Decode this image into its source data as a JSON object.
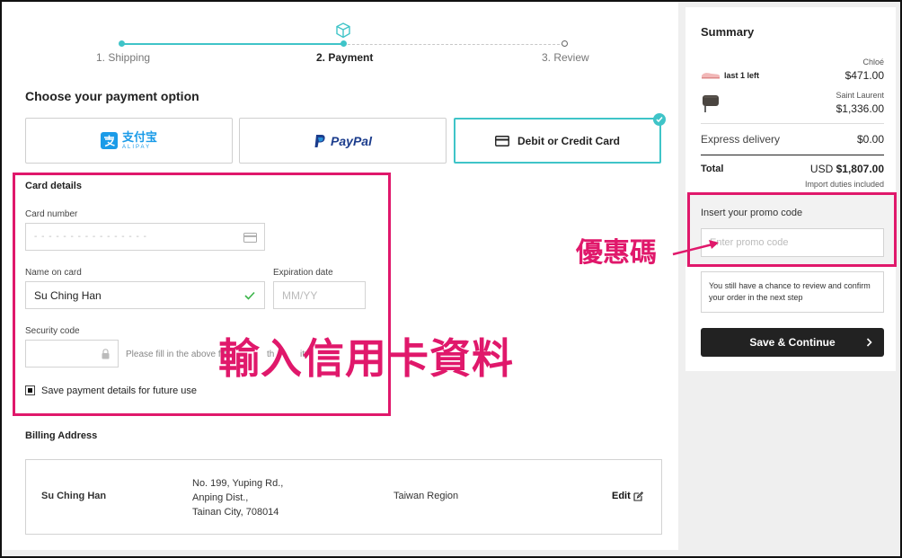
{
  "stepper": {
    "steps": [
      {
        "label": "1. Shipping"
      },
      {
        "label": "2. Payment"
      },
      {
        "label": "3. Review"
      }
    ],
    "active_index": 1,
    "accent": "#3fc4c8"
  },
  "payment": {
    "heading": "Choose your payment option",
    "options": [
      {
        "label": "支付宝",
        "sublabel": "ALIPAY"
      },
      {
        "label": "PayPal"
      },
      {
        "label": "Debit or Credit Card"
      }
    ],
    "selected_index": 2
  },
  "card": {
    "title": "Card details",
    "number_label": "Card number",
    "number_placeholder": "- - - -  - - - -  - - - -  - - - -",
    "name_label": "Name on card",
    "name_value": "Su Ching Han",
    "exp_label": "Expiration date",
    "exp_placeholder": "MM/YY",
    "cvv_label": "Security code",
    "cvv_hint_a": "Please fill in the above fie",
    "cvv_hint_b": "th",
    "cvv_hint_c": "ity",
    "save_label": "Save payment details for future use"
  },
  "billing": {
    "title": "Billing Address",
    "name": "Su Ching Han",
    "address_lines": [
      "No. 199, Yuping Rd.,",
      "Anping Dist.,",
      "Tainan City, 708014"
    ],
    "region": "Taiwan Region",
    "edit_label": "Edit"
  },
  "annotations": {
    "card_text": "輸入信用卡資料",
    "promo_text": "優惠碼",
    "color": "#e0186b"
  },
  "summary": {
    "title": "Summary",
    "items": [
      {
        "brand": "Chloé",
        "note": "last 1 left",
        "price": "$471.00"
      },
      {
        "brand": "Saint Laurent",
        "note": "",
        "price": "$1,336.00"
      }
    ],
    "delivery_label": "Express delivery",
    "delivery_price": "$0.00",
    "total_label": "Total",
    "total_currency": "USD",
    "total_value": "$1,807.00",
    "duties_note": "Import duties included",
    "promo_label": "Insert your promo code",
    "promo_placeholder": "Enter promo code",
    "review_note": "You still have a chance to review and confirm your order in the next step",
    "continue_label": "Save & Continue"
  }
}
